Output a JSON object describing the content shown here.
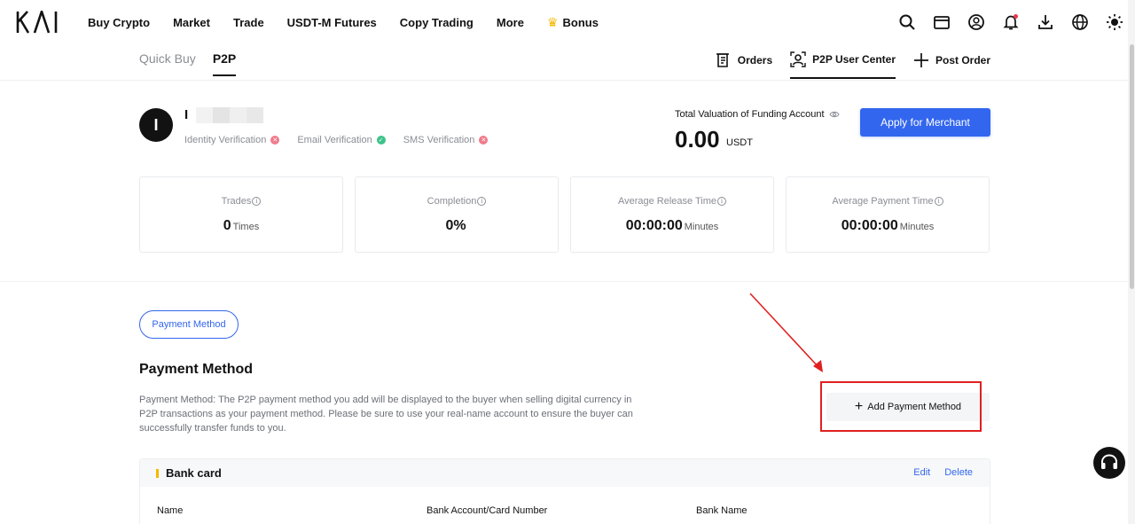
{
  "nav": {
    "logo": "KAI",
    "links": [
      "Buy Crypto",
      "Market",
      "Trade",
      "USDT-M Futures",
      "Copy Trading",
      "More"
    ],
    "bonus": "Bonus",
    "icons": [
      "search-icon",
      "wallet-icon",
      "account-icon",
      "bell-icon",
      "download-icon",
      "globe-icon",
      "theme-icon"
    ]
  },
  "subnav": {
    "tabs": [
      "Quick Buy",
      "P2P"
    ],
    "active_tab": "P2P",
    "orders": "Orders",
    "user_center": "P2P User Center",
    "post_order": "Post Order"
  },
  "profile": {
    "avatar_letter": "I",
    "name": "I",
    "verifications": [
      {
        "label": "Identity Verification",
        "status": "failed"
      },
      {
        "label": "Email Verification",
        "status": "verified"
      },
      {
        "label": "SMS Verification",
        "status": "failed"
      }
    ]
  },
  "funding": {
    "label": "Total Valuation of Funding Account",
    "amount": "0.00",
    "unit": "USDT",
    "merchant_button": "Apply for Merchant"
  },
  "stats": [
    {
      "label": "Trades",
      "value": "0",
      "unit": "Times"
    },
    {
      "label": "Completion",
      "value": "0%",
      "unit": ""
    },
    {
      "label": "Average Release Time",
      "value": "00:00:00",
      "unit": "Minutes"
    },
    {
      "label": "Average Payment Time",
      "value": "00:00:00",
      "unit": "Minutes"
    }
  ],
  "payment": {
    "tab": "Payment Method",
    "title": "Payment Method",
    "description": "Payment Method: The P2P payment method you add will be displayed to the buyer when selling digital currency in P2P transactions as your payment method. Please be sure to use your real-name account to ensure the buyer can successfully transfer funds to you.",
    "add_button": "Add Payment Method",
    "card": {
      "title": "Bank card",
      "edit": "Edit",
      "delete": "Delete",
      "columns": [
        "Name",
        "Bank Account/Card Number",
        "Bank Name"
      ]
    }
  },
  "colors": {
    "accent": "#3366ee",
    "highlight": "#e02020",
    "success": "#3ec28b",
    "error": "#f07a8a",
    "brand_yellow": "#f5b800"
  }
}
